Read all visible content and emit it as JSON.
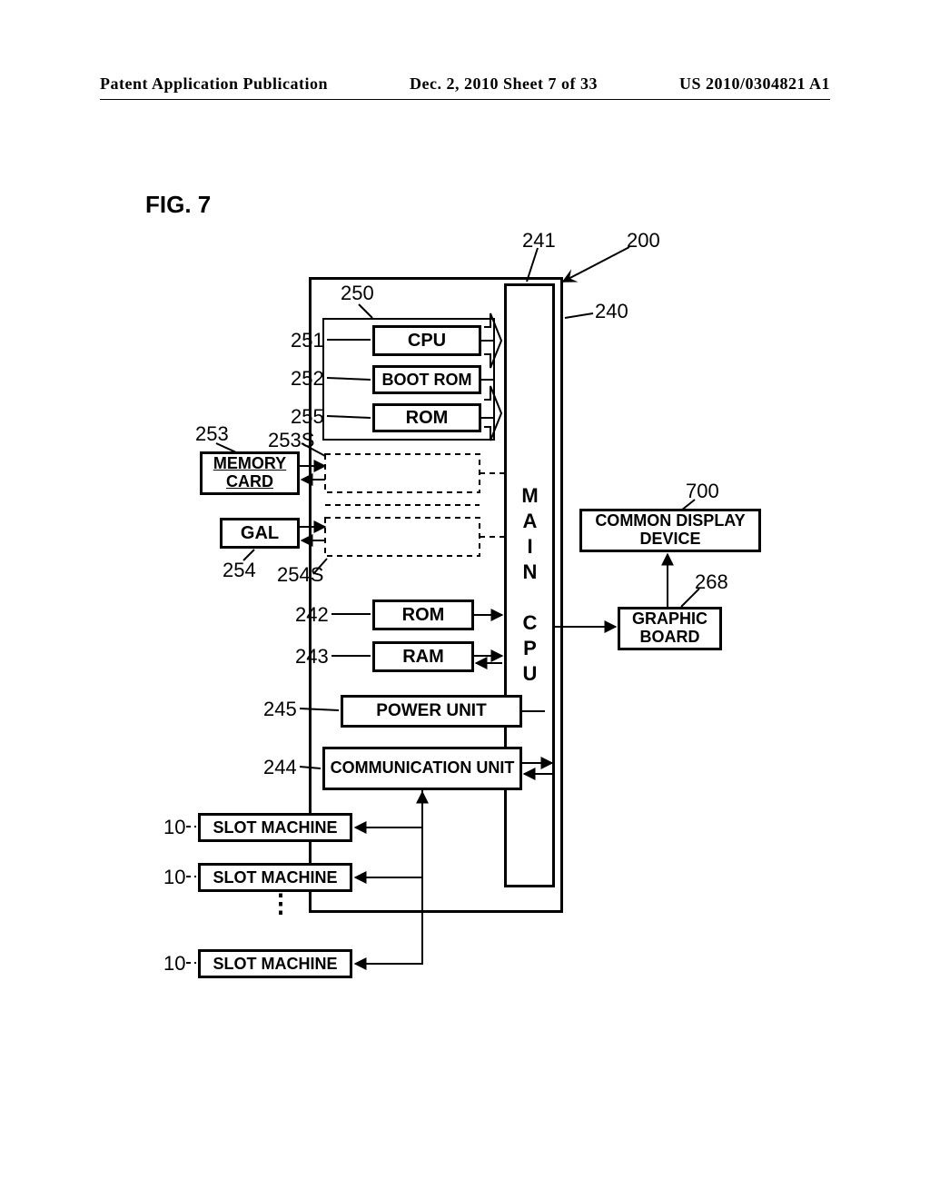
{
  "header": {
    "left": "Patent Application Publication",
    "center": "Dec. 2, 2010  Sheet 7 of 33",
    "right": "US 2010/0304821 A1"
  },
  "figure_label": "FIG. 7",
  "refs": {
    "r200": "200",
    "r240": "240",
    "r241": "241",
    "r250": "250",
    "r251": "251",
    "r252": "252",
    "r255": "255",
    "r253": "253",
    "r253S": "253S",
    "r254": "254",
    "r254S": "254S",
    "r242": "242",
    "r243": "243",
    "r245": "245",
    "r244": "244",
    "r700": "700",
    "r268": "268",
    "r10a": "10",
    "r10b": "10",
    "r10c": "10"
  },
  "blocks": {
    "cpu": "CPU",
    "bootrom": "BOOT ROM",
    "rom1": "ROM",
    "memcard": "MEMORY CARD",
    "gal": "GAL",
    "rom2": "ROM",
    "ram": "RAM",
    "power": "POWER UNIT",
    "comm": "COMMUNICATION UNIT",
    "maincpu": "MAIN CPU",
    "disp": "COMMON DISPLAY DEVICE",
    "graphic": "GRAPHIC BOARD",
    "slot1": "SLOT MACHINE",
    "slot2": "SLOT MACHINE",
    "slot3": "SLOT MACHINE"
  }
}
